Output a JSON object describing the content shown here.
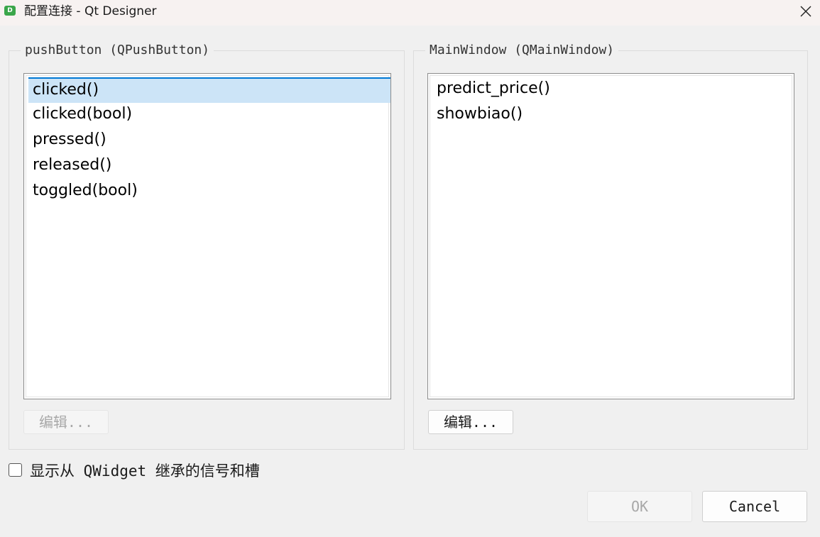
{
  "window": {
    "title": "配置连接 - Qt Designer",
    "app_icon_letter": "D"
  },
  "left_group": {
    "title": "pushButton (QPushButton)",
    "items": [
      "clicked()",
      "clicked(bool)",
      "pressed()",
      "released()",
      "toggled(bool)"
    ],
    "selected_index": 0,
    "edit_label": "编辑...",
    "edit_enabled": false
  },
  "right_group": {
    "title": "MainWindow (QMainWindow)",
    "items": [
      "predict_price()",
      "showbiao()"
    ],
    "edit_label": "编辑...",
    "edit_enabled": true
  },
  "show_inherited": {
    "label": "显示从 QWidget 继承的信号和槽",
    "checked": false
  },
  "buttons": {
    "ok_label": "OK",
    "ok_enabled": false,
    "cancel_label": "Cancel"
  },
  "colors": {
    "selection_bg": "#cce4f7",
    "selection_border": "#0078d4",
    "title_bg": "#f7f2f1",
    "app_icon": "#3aa64a"
  }
}
